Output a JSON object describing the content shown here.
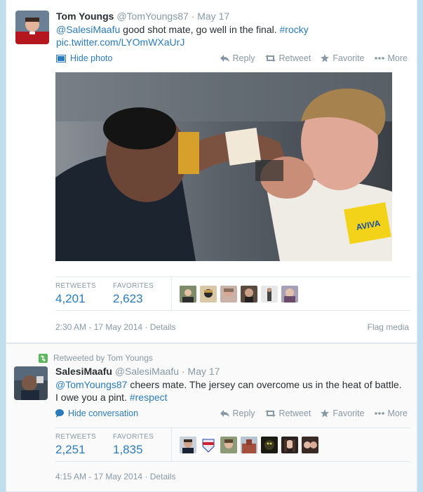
{
  "tweet1": {
    "fullname": "Tom Youngs",
    "username": "@TomYoungs87",
    "date": "May 17",
    "mention": "@SalesiMaafu",
    "text": " good shot mate, go well in the final. ",
    "hashtag": "#rocky",
    "pic_link": "pic.twitter.com/LYOmWXaUrJ",
    "toggle_label": "Hide photo",
    "actions": {
      "reply": "Reply",
      "retweet": "Retweet",
      "favorite": "Favorite",
      "more": "More"
    },
    "stats": {
      "retweets_label": "RETWEETS",
      "retweets": "4,201",
      "favorites_label": "FAVORITES",
      "favorites": "2,623"
    },
    "timestamp": "2:30 AM - 17 May 2014",
    "details": "Details",
    "flag": "Flag media"
  },
  "tweet2": {
    "retweeted_by": "Retweeted by Tom Youngs",
    "fullname": "SalesiMaafu",
    "username": "@SalesiMaafu",
    "date": "May 17",
    "mention": "@TomYoungs87",
    "text_line1": " cheers mate. The jersey can overcome us in the heat of battle.",
    "text_line2": "I owe you a pint. ",
    "hashtag": "#respect",
    "toggle_label": "Hide conversation",
    "actions": {
      "reply": "Reply",
      "retweet": "Retweet",
      "favorite": "Favorite",
      "more": "More"
    },
    "stats": {
      "retweets_label": "RETWEETS",
      "retweets": "2,251",
      "favorites_label": "FAVORITES",
      "favorites": "1,835"
    },
    "timestamp": "4:15 AM - 17 May 2014",
    "details": "Details"
  },
  "colors": {
    "link": "#2a7bbd",
    "muted": "#8899a6",
    "background": "#c0deed",
    "retweet_green": "#5bb75b"
  }
}
